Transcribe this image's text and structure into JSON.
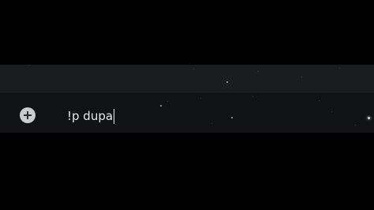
{
  "composer": {
    "attach_icon": "plus-circle-icon",
    "input_value": "!p dupa"
  },
  "colors": {
    "letterbox": "#000000",
    "message_area": "#1b1c1d",
    "composer_bg": "#111213",
    "text": "#e6e7e9",
    "attach_button": "#c9cbcf"
  }
}
